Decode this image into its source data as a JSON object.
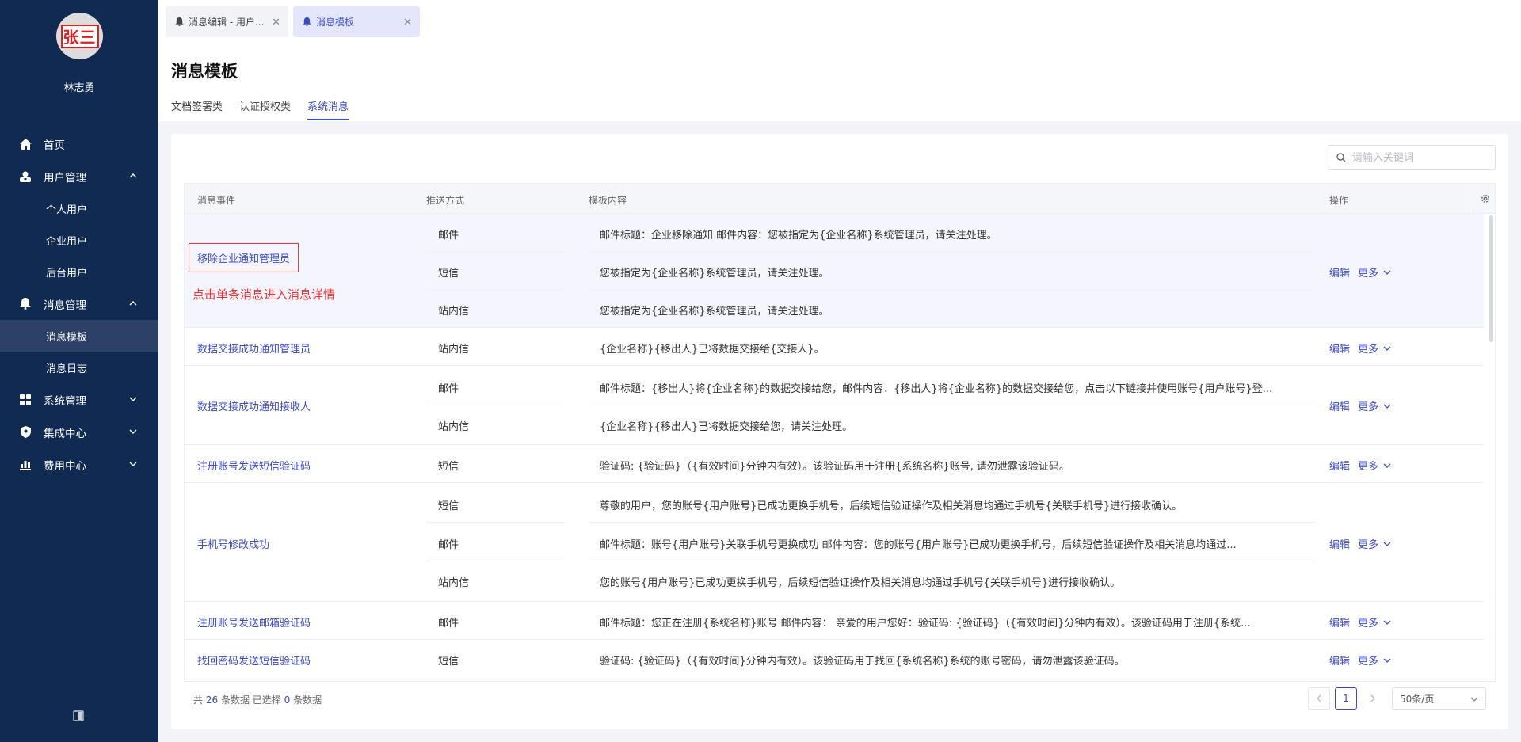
{
  "sidebar": {
    "avatar_text": "张三",
    "username": "林志勇",
    "menu": {
      "home": "首页",
      "user_mgmt": "用户管理",
      "user_sub": [
        "个人用户",
        "企业用户",
        "后台用户"
      ],
      "msg_mgmt": "消息管理",
      "msg_sub": [
        "消息模板",
        "消息日志"
      ],
      "system": "系统管理",
      "integration": "集成中心",
      "billing": "费用中心"
    }
  },
  "top_tabs": [
    "消息编辑 - 用户...",
    "消息模板"
  ],
  "page": {
    "title": "消息模板",
    "tabs": [
      "文档签署类",
      "认证授权类",
      "系统消息"
    ]
  },
  "search": {
    "placeholder": "请输入关键词"
  },
  "table": {
    "headers": [
      "消息事件",
      "推送方式",
      "模板内容",
      "操作"
    ],
    "edit_label": "编辑",
    "more_label": "更多",
    "rows": [
      {
        "event": "移除企业通知管理员",
        "items": [
          {
            "method": "邮件",
            "content": "邮件标题：企业移除通知 邮件内容：您被指定为{企业名称}系统管理员，请关注处理。"
          },
          {
            "method": "短信",
            "content": "您被指定为{企业名称}系统管理员，请关注处理。"
          },
          {
            "method": "站内信",
            "content": "您被指定为{企业名称}系统管理员，请关注处理。"
          }
        ]
      },
      {
        "event": "数据交接成功通知管理员",
        "items": [
          {
            "method": "站内信",
            "content": "{企业名称}{移出人}已将数据交接给{交接人}。"
          }
        ]
      },
      {
        "event": "数据交接成功通知接收人",
        "items": [
          {
            "method": "邮件",
            "content": "邮件标题：{移出人}将{企业名称}的数据交接给您，邮件内容：{移出人}将{企业名称}的数据交接给您，点击以下链接并使用账号{用户账号}登..."
          },
          {
            "method": "站内信",
            "content": "{企业名称}{移出人}已将数据交接给您，请关注处理。"
          }
        ]
      },
      {
        "event": "注册账号发送短信验证码",
        "items": [
          {
            "method": "短信",
            "content": "验证码: {验证码}（{有效时间}分钟内有效）。该验证码用于注册{系统名称}账号, 请勿泄露该验证码。"
          }
        ]
      },
      {
        "event": "手机号修改成功",
        "items": [
          {
            "method": "短信",
            "content": "尊敬的用户，您的账号{用户账号}已成功更换手机号，后续短信验证操作及相关消息均通过手机号{关联手机号}进行接收确认。"
          },
          {
            "method": "邮件",
            "content": "邮件标题：账号{用户账号}关联手机号更换成功 邮件内容：您的账号{用户账号}已成功更换手机号，后续短信验证操作及相关消息均通过..."
          },
          {
            "method": "站内信",
            "content": "您的账号{用户账号}已成功更换手机号，后续短信验证操作及相关消息均通过手机号{关联手机号}进行接收确认。"
          }
        ]
      },
      {
        "event": "注册账号发送邮箱验证码",
        "items": [
          {
            "method": "邮件",
            "content": "邮件标题：您正在注册{系统名称}账号 邮件内容： 亲爱的用户您好：验证码: {验证码}（{有效时间}分钟内有效）。该验证码用于注册{系统..."
          }
        ]
      },
      {
        "event": "找回密码发送短信验证码",
        "items": [
          {
            "method": "短信",
            "content": "验证码: {验证码}（{有效时间}分钟内有效）。该验证码用于找回{系统名称}系统的账号密码，请勿泄露该验证码。"
          }
        ]
      }
    ]
  },
  "annotation": "点击单条消息进入消息详情",
  "footer": {
    "prefix": "共",
    "total": "26",
    "mid": "条数据  已选择",
    "selected": "0",
    "suffix": "条数据",
    "current_page": "1",
    "page_size": "50条/页"
  },
  "colors": {
    "sidebar_bg": "#102a52",
    "accent": "#3b49c9",
    "annotation": "#e33333"
  }
}
